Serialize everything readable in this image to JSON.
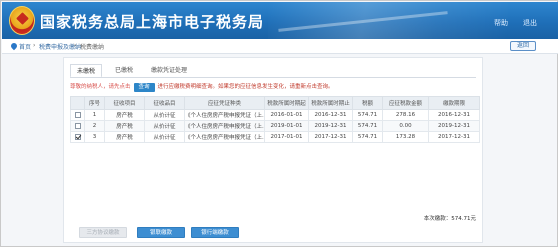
{
  "header": {
    "title": "国家税务总局上海市电子税务局",
    "links": [
      "帮助",
      "退出"
    ]
  },
  "breadcrumb": {
    "items": [
      "首页",
      "税费申报及缴纳",
      "税费缴纳"
    ],
    "back_label": "返回"
  },
  "tabs": [
    {
      "label": "未缴税",
      "active": true
    },
    {
      "label": "已缴税",
      "active": false
    },
    {
      "label": "缴款凭证处理",
      "active": false
    }
  ],
  "notice": {
    "lead": "尊敬的纳税人，请先点击",
    "button": "查询",
    "trail": "进行应缴税费明细查询。如果您的应征信息发生变化，请重新点击查询。"
  },
  "table": {
    "columns": [
      "",
      "序号",
      "征收项目",
      "征收品目",
      "应征凭证种类",
      "税款所属时期起",
      "税款所属时期止",
      "税额",
      "应征税款金额",
      "缴款期限"
    ],
    "rows": [
      {
        "checked": false,
        "cells": [
          "1",
          "房产税",
          "从价计征",
          "《个人住房房产税申报凭证（上...",
          "2016-01-01",
          "2016-12-31",
          "574.71",
          "278.16",
          "2016-12-31"
        ]
      },
      {
        "checked": false,
        "cells": [
          "2",
          "房产税",
          "从价计征",
          "《个人住房房产税申报凭证（上...",
          "2019-01-01",
          "2019-12-31",
          "574.71",
          "0.00",
          "2019-12-31"
        ]
      },
      {
        "checked": true,
        "cells": [
          "3",
          "房产税",
          "从价计征",
          "《个人住房房产税申报凭证（上...",
          "2017-01-01",
          "2017-12-31",
          "574.71",
          "173.28",
          "2017-12-31"
        ]
      }
    ]
  },
  "total": {
    "label": "本次缴款：",
    "value": "574.71元"
  },
  "buttons": {
    "third_party": "三方协议缴款",
    "card_pay": "银联缴款",
    "bank_pay": "银行端缴款"
  },
  "colors": {
    "header_blue": "#1f6fb8",
    "accent_blue": "#3d8ed2",
    "notice_red": "#d9534f"
  }
}
